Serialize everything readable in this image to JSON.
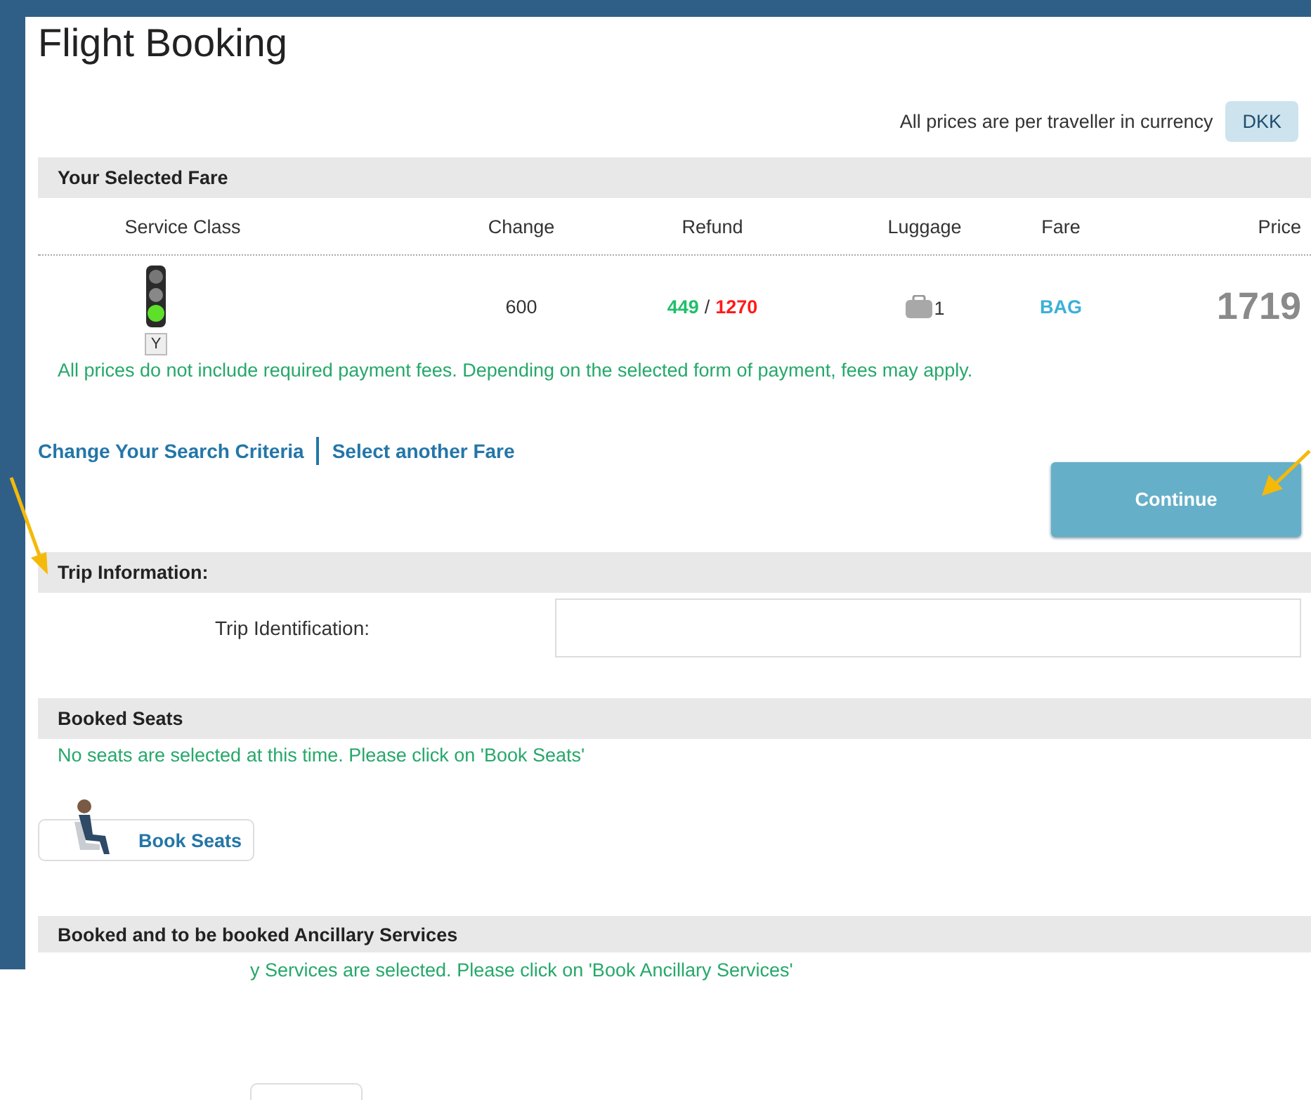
{
  "title": "Flight Booking",
  "currency": {
    "label": "All prices are per traveller in currency",
    "code": "DKK"
  },
  "selected_fare": {
    "heading": "Your Selected Fare",
    "columns": [
      "Service Class",
      "Change",
      "Refund",
      "Luggage",
      "Fare",
      "Price"
    ],
    "row": {
      "service_class_code": "Y",
      "change": "600",
      "refund": {
        "separator": "/",
        "amounts": [
          {
            "value": "449",
            "color": "#1fbf6a"
          },
          {
            "value": "1270",
            "color": "#ff1a1a"
          }
        ]
      },
      "luggage_count": "1",
      "fare": "BAG",
      "price": "1719"
    },
    "note": "All prices do not include required payment fees. Depending on the selected form of payment, fees may apply."
  },
  "links": [
    "Change Your Search Criteria",
    "Select another Fare"
  ],
  "continue_button": "Continue",
  "trip_information": {
    "heading": "Trip Information:",
    "label": "Trip Identification:"
  },
  "booked_seats": {
    "heading": "Booked Seats",
    "note": "No seats are selected at this time. Please click on 'Book Seats'",
    "button": "Book Seats"
  },
  "ancillary": {
    "heading": "Booked and to be booked Ancillary Services",
    "note": "y Services are selected. Please click on 'Book Ancillary Services'"
  }
}
